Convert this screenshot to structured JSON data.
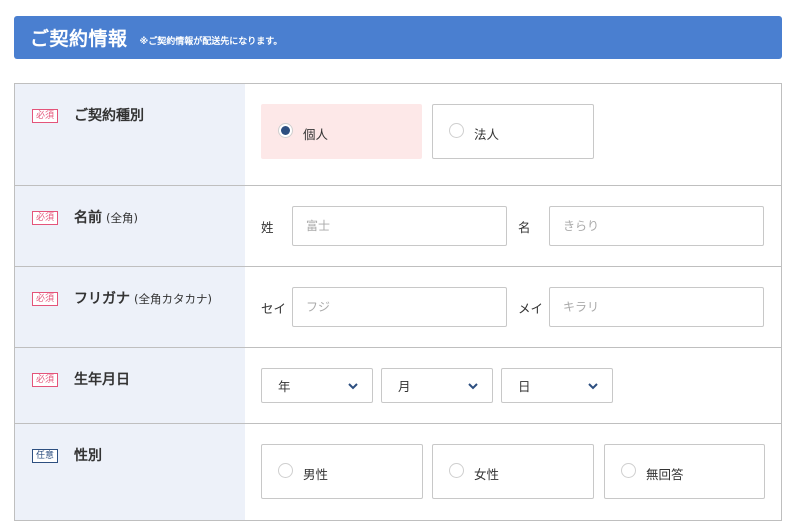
{
  "header": {
    "title": "ご契約情報",
    "note": "※ご契約情報が配送先になります。"
  },
  "colors": {
    "header_bg": "#4a7fd0",
    "label_bg": "#edf1f9",
    "required": "#e4547a",
    "optional": "#2d4f80",
    "selected_bg": "#fde8e8"
  },
  "rows": {
    "contract_type": {
      "badge": "必須",
      "label": "ご契約種別",
      "options": [
        {
          "label": "個人",
          "selected": true
        },
        {
          "label": "法人",
          "selected": false
        }
      ]
    },
    "name": {
      "badge": "必須",
      "label": "名前",
      "sub": "(全角)",
      "last_label": "姓",
      "last_placeholder": "富士",
      "first_label": "名",
      "first_placeholder": "きらり"
    },
    "furigana": {
      "badge": "必須",
      "label": "フリガナ",
      "sub": "(全角カタカナ)",
      "last_label": "セイ",
      "last_placeholder": "フジ",
      "first_label": "メイ",
      "first_placeholder": "キラリ"
    },
    "birthdate": {
      "badge": "必須",
      "label": "生年月日",
      "year": "年",
      "month": "月",
      "day": "日"
    },
    "gender": {
      "badge": "任意",
      "label": "性別",
      "options": [
        {
          "label": "男性",
          "selected": false
        },
        {
          "label": "女性",
          "selected": false
        },
        {
          "label": "無回答",
          "selected": false
        }
      ]
    }
  }
}
